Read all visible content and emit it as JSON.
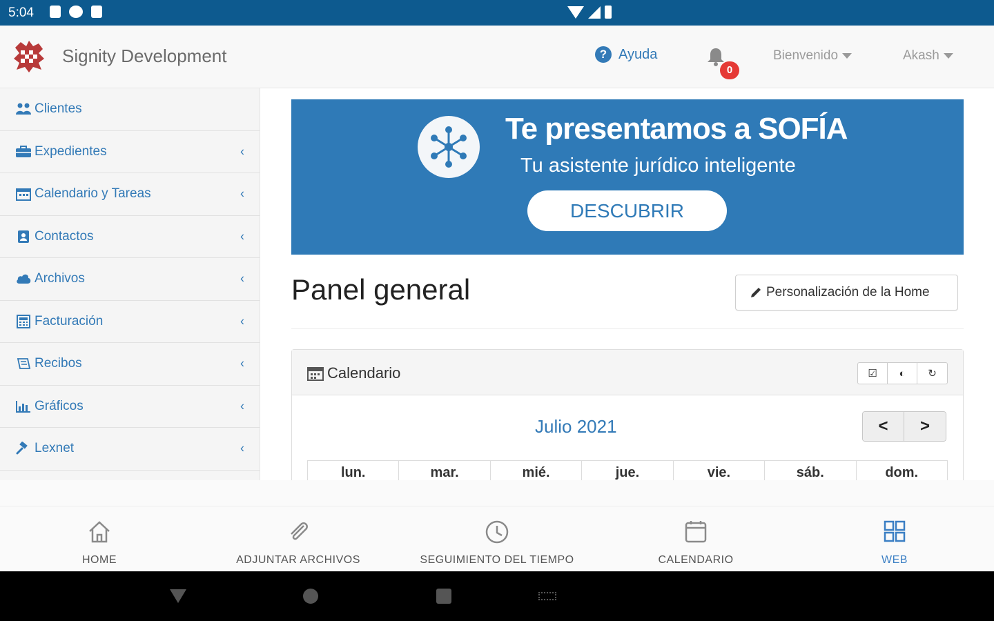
{
  "status_bar": {
    "time": "5:04"
  },
  "header": {
    "brand": "Signity Development",
    "help_label": "Ayuda",
    "notification_count": "0",
    "welcome_label": "Bienvenido",
    "user_label": "Akash"
  },
  "sidebar": {
    "items": [
      {
        "label": "Clientes",
        "icon": "users-icon",
        "has_submenu": false
      },
      {
        "label": "Expedientes",
        "icon": "briefcase-icon",
        "has_submenu": true
      },
      {
        "label": "Calendario y Tareas",
        "icon": "calendar-icon",
        "has_submenu": true
      },
      {
        "label": "Contactos",
        "icon": "contact-card-icon",
        "has_submenu": true
      },
      {
        "label": "Archivos",
        "icon": "cloud-icon",
        "has_submenu": true
      },
      {
        "label": "Facturación",
        "icon": "calculator-icon",
        "has_submenu": true
      },
      {
        "label": "Recibos",
        "icon": "receipt-icon",
        "has_submenu": true
      },
      {
        "label": "Gráficos",
        "icon": "bar-chart-icon",
        "has_submenu": true
      },
      {
        "label": "Lexnet",
        "icon": "gavel-icon",
        "has_submenu": true
      }
    ]
  },
  "banner": {
    "title": "Te presentamos a SOFÍA",
    "subtitle": "Tu asistente jurídico inteligente",
    "cta": "DESCUBRIR",
    "bg_color": "#2f7ab7"
  },
  "main": {
    "page_title": "Panel general",
    "customize_button": "Personalización de la Home"
  },
  "calendar_panel": {
    "title": "Calendario",
    "month": "Julio 2021",
    "prev": "<",
    "next": ">",
    "weekdays": [
      "lun.",
      "mar.",
      "mié.",
      "jue.",
      "vie.",
      "sáb.",
      "dom."
    ]
  },
  "bottom_nav": {
    "items": [
      {
        "label": "HOME",
        "icon": "home-icon",
        "active": false
      },
      {
        "label": "ADJUNTAR ARCHIVOS",
        "icon": "paperclip-icon",
        "active": false
      },
      {
        "label": "SEGUIMIENTO DEL TIEMPO",
        "icon": "clock-icon",
        "active": false
      },
      {
        "label": "CALENDARIO",
        "icon": "calendar-icon",
        "active": false
      },
      {
        "label": "WEB",
        "icon": "grid-icon",
        "active": true
      }
    ]
  },
  "colors": {
    "accent": "#337ab7",
    "status_bar": "#0d5a8f",
    "badge": "#e53935"
  }
}
